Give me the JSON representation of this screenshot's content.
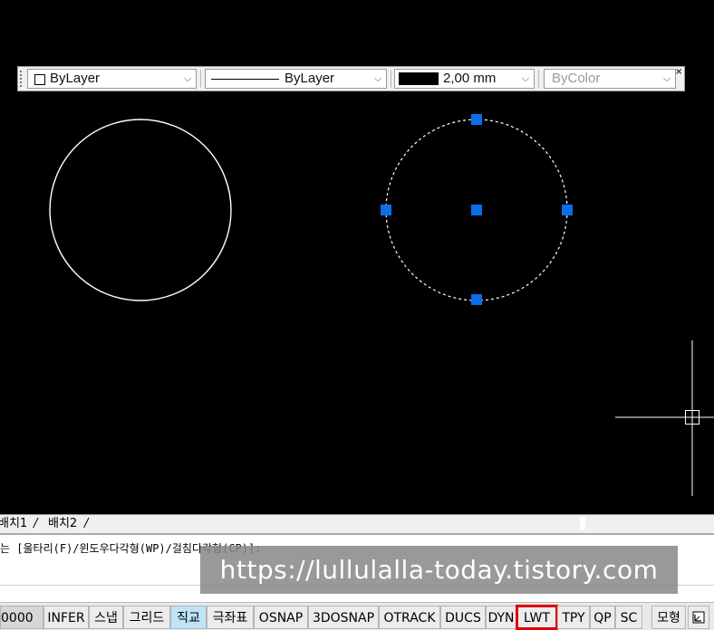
{
  "properties_toolbar": {
    "color_label": "ByLayer",
    "linetype_label": "ByLayer",
    "lineweight_label": "2,00 mm",
    "plotstyle_label": "ByColor",
    "close_glyph": "×"
  },
  "drawing": {
    "grip_color": "#0a6ee6",
    "crosshair_color": "#ffffff"
  },
  "tabs": {
    "layout1": "배치1",
    "layout2": "배치2"
  },
  "command": {
    "prompt": "는 [울타리(F)/윈도우다각형(WP)/걸침다각형(CP)]:"
  },
  "watermark": "https://lullulalla-today.tistory.com",
  "status": {
    "coord": "0000",
    "infer": "INFER",
    "snap": "스냅",
    "grid": "그리드",
    "ortho": "직교",
    "polar": "극좌표",
    "osnap": "OSNAP",
    "osnap3d": "3DOSNAP",
    "otrack": "OTRACK",
    "ducs": "DUCS",
    "dyn": "DYN",
    "lwt": "LWT",
    "tpy": "TPY",
    "qp": "QP",
    "sc": "SC",
    "model": "모형",
    "highlight_color": "#e00000"
  }
}
